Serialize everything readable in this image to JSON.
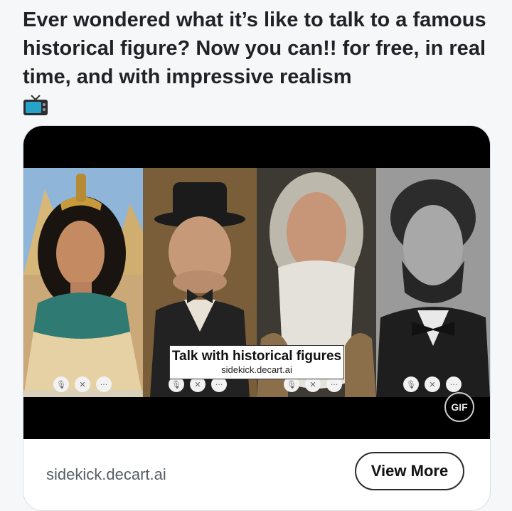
{
  "post": {
    "text": "Ever wondered what it’s like to talk to a famous historical figure? Now you can!! for free, in real time, and with impressive realism",
    "emoji_icon": "television-icon"
  },
  "media": {
    "caption_title": "Talk with historical figures",
    "caption_subtitle": "sidekick.decart.ai",
    "gif_label": "GIF",
    "controls": {
      "mic": "🎙",
      "close": "✕",
      "more": "···"
    },
    "panels": [
      "cleopatra-portrait",
      "churchill-portrait",
      "bearded-sage-portrait",
      "lincoln-portrait"
    ]
  },
  "link_card": {
    "domain": "sidekick.decart.ai",
    "button_label": "View More"
  }
}
